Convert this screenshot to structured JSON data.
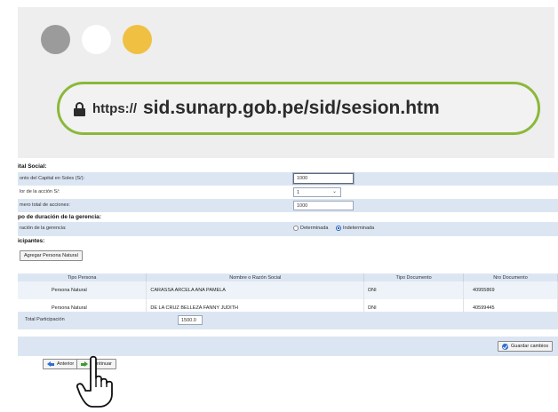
{
  "browser": {
    "url_protocol": "https://",
    "url_host": "sid.sunarp.gob.pe/sid/sesion.htm",
    "dots": [
      "#9b9b9b",
      "#ffffff",
      "#f0c043"
    ],
    "accent": "#8bb83a"
  },
  "form": {
    "capital_heading": "ital Social:",
    "monto_label": "onto del Capital en Soles (S/):",
    "monto_value": "1000",
    "valor_label": "lor de la acción S/:",
    "valor_value": "1",
    "numero_label": "mero total de acciones:",
    "numero_value": "1000",
    "plazo_heading": "po de duración de la gerencia:",
    "duracion_label": "ración de la gerencia:",
    "radio_determinada": "Determinada",
    "radio_indeterminada": "Indeterminada",
    "participantes_heading": "icipantes:",
    "agregar_button": "Agregar Persona Natural",
    "table": {
      "headers": [
        "Tipo Persona",
        "Nombre o Razón Social",
        "Tipo Documento",
        "Nro Documento"
      ],
      "rows": [
        [
          "Persona Natural",
          "CARASSA ARCELA ANA PAMELA",
          "DNI",
          "40955869"
        ],
        [
          "Persona Natural",
          "DE LA CRUZ BELLEZA FANNY JUDITH",
          "DNI",
          "40599445"
        ]
      ]
    },
    "total_label": "Total Participación",
    "total_value": "1500.0",
    "guardar_button": "Guardar cambios",
    "anterior_button": "Anterior",
    "continuar_button": "Continuar"
  },
  "icons": {
    "lock": "lock-icon",
    "cursor": "hand-pointer-icon"
  }
}
